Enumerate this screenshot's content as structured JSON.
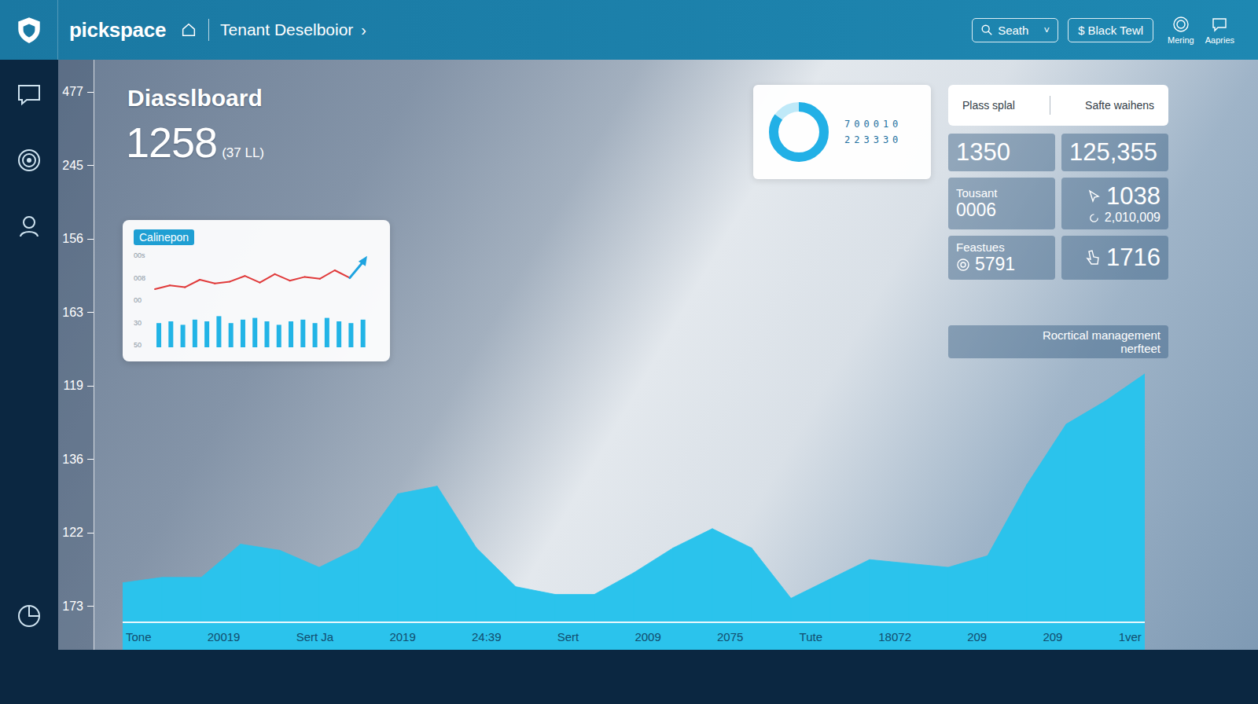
{
  "app": {
    "name": "pickspace"
  },
  "breadcrumb": {
    "title": "Tenant Deselboior",
    "chevron": "›"
  },
  "toolbar": {
    "search": {
      "label": "Seath",
      "chevron": "˅"
    },
    "button": {
      "icon": "$",
      "label": "Black Tewl"
    },
    "actions": [
      {
        "label": "Mering"
      },
      {
        "label": "Aapries"
      }
    ]
  },
  "y_axis": {
    "ticks": [
      "477",
      "245",
      "156",
      "163",
      "119",
      "136",
      "122",
      "173"
    ]
  },
  "header": {
    "title": "Diasslboard",
    "value": "1258",
    "note": "(37 LL)"
  },
  "mini_chart": {
    "tag": "Calinepon",
    "ticks": [
      "00s",
      "008",
      "00",
      "30",
      "50"
    ],
    "line": [
      30,
      38,
      34,
      50,
      42,
      46,
      58,
      44,
      62,
      48,
      56,
      52,
      70,
      54,
      92
    ],
    "bars": [
      28,
      30,
      26,
      32,
      30,
      36,
      28,
      32,
      34,
      30,
      26,
      30,
      32,
      28,
      34,
      30,
      28,
      32
    ]
  },
  "donut": {
    "level": 0.85,
    "rows": [
      "700010",
      "223330"
    ]
  },
  "summary": {
    "labels": [
      "Plass splal",
      "Safte waihens"
    ]
  },
  "stats": [
    {
      "kind": "big",
      "value": "1350"
    },
    {
      "kind": "big",
      "value": "125,355"
    },
    {
      "kind": "labeled",
      "label": "Tousant",
      "value": "0006"
    },
    {
      "kind": "pointer",
      "value": "1038",
      "sub": "2,010,009"
    },
    {
      "kind": "marked",
      "label": "Feastues",
      "value": "5791"
    },
    {
      "kind": "hand",
      "value": "1716"
    }
  ],
  "note": {
    "lines": [
      "Rocrtical management",
      "nerfteet"
    ]
  },
  "area_chart": {
    "values": [
      50,
      57,
      57,
      100,
      92,
      70,
      95,
      165,
      175,
      95,
      45,
      35,
      35,
      63,
      95,
      120,
      95,
      30,
      55,
      80,
      75,
      70,
      85,
      177,
      255,
      285,
      320
    ],
    "x_labels": [
      "Tone",
      "20019",
      "Sert Ja",
      "2019",
      "24:39",
      "Sert",
      "2009",
      "2075",
      "Tute",
      "18072",
      "209",
      "209",
      "1ver"
    ]
  }
}
